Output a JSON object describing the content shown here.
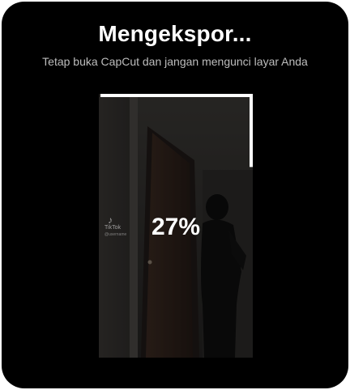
{
  "dialog": {
    "title": "Mengekspor...",
    "subtitle": "Tetap buka CapCut dan jangan mengunci layar Anda"
  },
  "preview": {
    "progress_percent_label": "27%",
    "progress_fraction": 0.27,
    "watermark": {
      "icon": "tiktok-logo-icon",
      "brand": "TikTok",
      "username": "@username"
    }
  },
  "colors": {
    "background": "#000000",
    "title": "#ffffff",
    "subtitle": "#bdbdbd",
    "progress": "#ffffff"
  }
}
